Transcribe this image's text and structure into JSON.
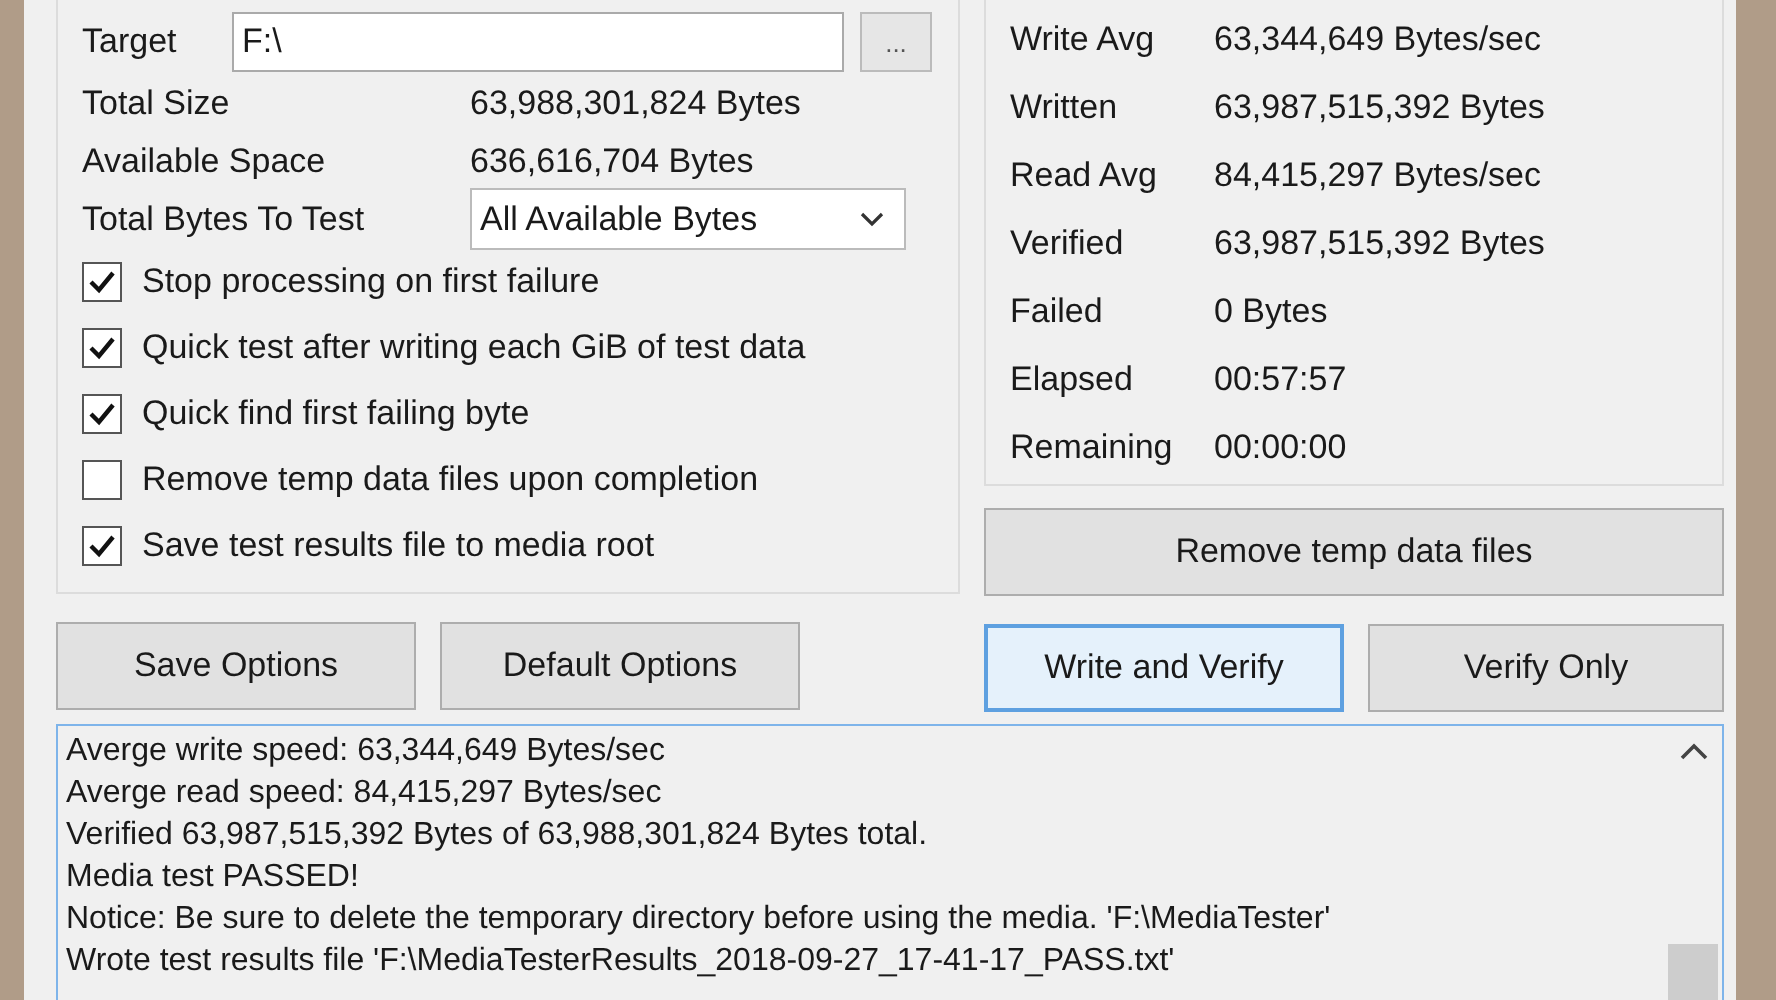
{
  "target": {
    "label": "Target",
    "value": "F:\\",
    "browse": "..."
  },
  "info": [
    {
      "label": "Total Size",
      "value": "63,988,301,824 Bytes"
    },
    {
      "label": "Available Space",
      "value": "636,616,704 Bytes"
    }
  ],
  "bytes_to_test": {
    "label": "Total Bytes To Test",
    "value": "All Available Bytes"
  },
  "options": [
    {
      "label": "Stop processing on first failure",
      "checked": true
    },
    {
      "label": "Quick test after writing each GiB of test data",
      "checked": true
    },
    {
      "label": "Quick find first failing byte",
      "checked": true
    },
    {
      "label": "Remove temp data files upon completion",
      "checked": false
    },
    {
      "label": "Save test results file to media root",
      "checked": true
    }
  ],
  "stats": [
    {
      "label": "Write Avg",
      "value": "63,344,649 Bytes/sec"
    },
    {
      "label": "Written",
      "value": "63,987,515,392 Bytes"
    },
    {
      "label": "Read Avg",
      "value": "84,415,297 Bytes/sec"
    },
    {
      "label": "Verified",
      "value": "63,987,515,392 Bytes"
    },
    {
      "label": "Failed",
      "value": "0 Bytes"
    },
    {
      "label": "Elapsed",
      "value": "00:57:57"
    },
    {
      "label": "Remaining",
      "value": "00:00:00"
    }
  ],
  "remove_button": "Remove temp data files",
  "left_buttons": [
    {
      "label": "Save Options",
      "focused": false
    },
    {
      "label": "Default Options",
      "focused": false
    }
  ],
  "right_buttons": [
    {
      "label": "Write and Verify",
      "focused": true
    },
    {
      "label": "Verify Only",
      "focused": false
    }
  ],
  "log": [
    "Averge write speed: 63,344,649 Bytes/sec",
    "Averge read speed: 84,415,297 Bytes/sec",
    "Verified 63,987,515,392 Bytes of 63,988,301,824 Bytes total.",
    "Media test PASSED!",
    "Notice: Be sure to delete the temporary directory before using the media. 'F:\\MediaTester'",
    "Wrote test results file 'F:\\MediaTesterResults_2018-09-27_17-41-17_PASS.txt'"
  ]
}
